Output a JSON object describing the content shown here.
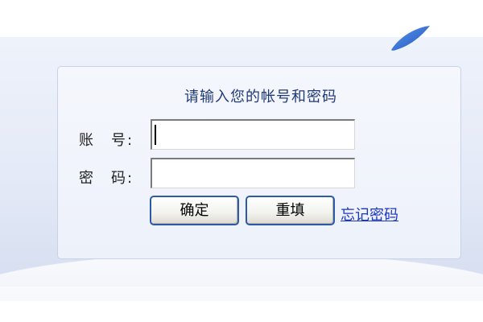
{
  "login": {
    "title": "请输入您的帐号和密码",
    "account_label_1": "账",
    "account_label_2": "号",
    "password_label_1": "密",
    "password_label_2": "码",
    "colon": ":",
    "account_value": "",
    "password_value": "",
    "confirm_label": "确定",
    "reset_label": "重填",
    "forgot_label": "忘记密码"
  },
  "colors": {
    "title": "#1f3a78",
    "link": "#1a36c4",
    "button_border": "#2d5aa8",
    "swoosh": "#2f6fd6"
  },
  "icons": {
    "swoosh": "swoosh-logo-icon"
  }
}
